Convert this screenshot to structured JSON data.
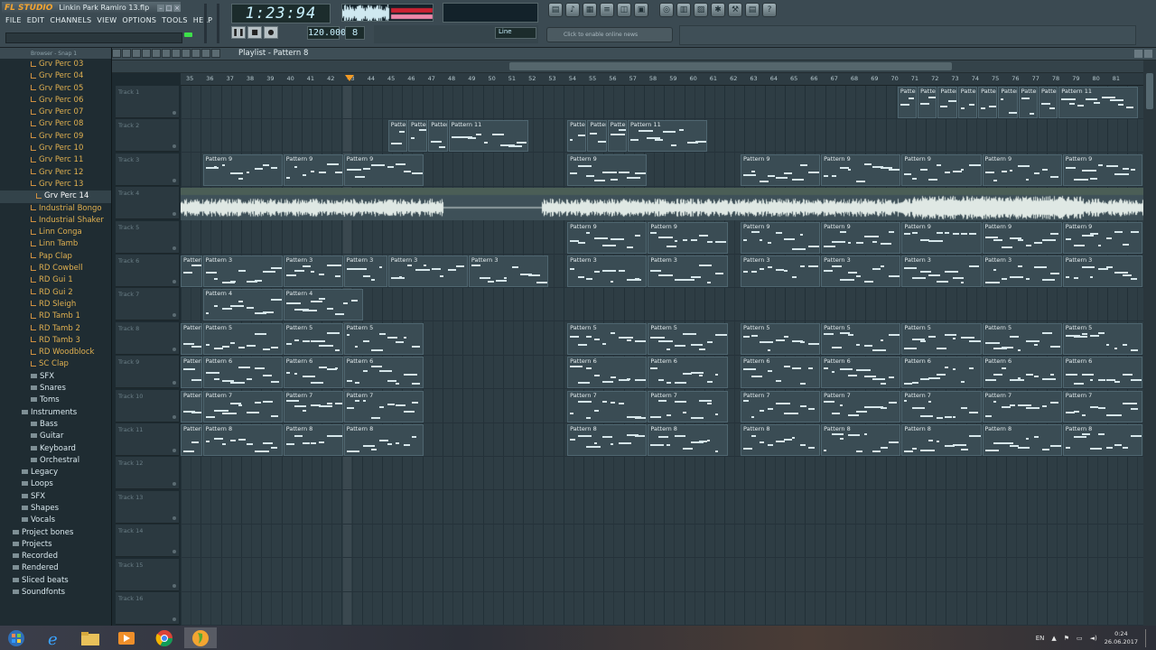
{
  "app": {
    "logo": "FL STUDIO",
    "file_name": "Linkin Park Ramiro 13.flp"
  },
  "menu": [
    "FILE",
    "EDIT",
    "CHANNELS",
    "VIEW",
    "OPTIONS",
    "TOOLS",
    "HELP"
  ],
  "transport": {
    "time": "1:23:94",
    "tempo": "120.000",
    "pattern_num": "8",
    "snap": "Line"
  },
  "news_text": "Click to enable online news",
  "browser": {
    "header": "Browser - Snap 1",
    "items": [
      {
        "label": "Grv Perc 03",
        "kind": "file",
        "indent": 1
      },
      {
        "label": "Grv Perc 04",
        "kind": "file",
        "indent": 1
      },
      {
        "label": "Grv Perc 05",
        "kind": "file",
        "indent": 1
      },
      {
        "label": "Grv Perc 06",
        "kind": "file",
        "indent": 1
      },
      {
        "label": "Grv Perc 07",
        "kind": "file",
        "indent": 1
      },
      {
        "label": "Grv Perc 08",
        "kind": "file",
        "indent": 1
      },
      {
        "label": "Grv Perc 09",
        "kind": "file",
        "indent": 1
      },
      {
        "label": "Grv Perc 10",
        "kind": "file",
        "indent": 1
      },
      {
        "label": "Grv Perc 11",
        "kind": "file",
        "indent": 1
      },
      {
        "label": "Grv Perc 12",
        "kind": "file",
        "indent": 1
      },
      {
        "label": "Grv Perc 13",
        "kind": "file",
        "indent": 1
      },
      {
        "label": "Grv Perc 14",
        "kind": "file",
        "indent": 1,
        "selected": true
      },
      {
        "label": "Industrial Bongo",
        "kind": "file",
        "indent": 1
      },
      {
        "label": "Industrial Shaker",
        "kind": "file",
        "indent": 1
      },
      {
        "label": "Linn Conga",
        "kind": "file",
        "indent": 1
      },
      {
        "label": "Linn Tamb",
        "kind": "file",
        "indent": 1
      },
      {
        "label": "Pap Clap",
        "kind": "file",
        "indent": 1
      },
      {
        "label": "RD Cowbell",
        "kind": "file",
        "indent": 1
      },
      {
        "label": "RD Gui 1",
        "kind": "file",
        "indent": 1
      },
      {
        "label": "RD Gui 2",
        "kind": "file",
        "indent": 1
      },
      {
        "label": "RD Sleigh",
        "kind": "file",
        "indent": 1
      },
      {
        "label": "RD Tamb 1",
        "kind": "file",
        "indent": 1
      },
      {
        "label": "RD Tamb 2",
        "kind": "file",
        "indent": 1
      },
      {
        "label": "RD Tamb 3",
        "kind": "file",
        "indent": 1
      },
      {
        "label": "RD Woodblock",
        "kind": "file",
        "indent": 1
      },
      {
        "label": "SC Clap",
        "kind": "file",
        "indent": 1
      },
      {
        "label": "SFX",
        "kind": "folder",
        "indent": 1
      },
      {
        "label": "Snares",
        "kind": "folder",
        "indent": 1
      },
      {
        "label": "Toms",
        "kind": "folder",
        "indent": 1
      },
      {
        "label": "Instruments",
        "kind": "folder",
        "indent": 0
      },
      {
        "label": "Bass",
        "kind": "folder",
        "indent": 1
      },
      {
        "label": "Guitar",
        "kind": "folder",
        "indent": 1
      },
      {
        "label": "Keyboard",
        "kind": "folder",
        "indent": 1
      },
      {
        "label": "Orchestral",
        "kind": "folder",
        "indent": 1
      },
      {
        "label": "Legacy",
        "kind": "folder",
        "indent": 0
      },
      {
        "label": "Loops",
        "kind": "folder",
        "indent": 0
      },
      {
        "label": "SFX",
        "kind": "folder",
        "indent": 0
      },
      {
        "label": "Shapes",
        "kind": "folder",
        "indent": 0
      },
      {
        "label": "Vocals",
        "kind": "folder",
        "indent": 0
      },
      {
        "label": "Project bones",
        "kind": "folder",
        "indent": -1
      },
      {
        "label": "Projects",
        "kind": "folder",
        "indent": -1
      },
      {
        "label": "Recorded",
        "kind": "folder",
        "indent": -1
      },
      {
        "label": "Rendered",
        "kind": "folder",
        "indent": -1
      },
      {
        "label": "Sliced beats",
        "kind": "folder",
        "indent": -1
      },
      {
        "label": "Soundfonts",
        "kind": "folder",
        "indent": -1
      }
    ]
  },
  "playlist": {
    "title": "Playlist - Pattern 8",
    "ruler_ticks": [
      "35",
      "36",
      "37",
      "38",
      "39",
      "40",
      "41",
      "42",
      "43",
      "44",
      "45",
      "46",
      "47",
      "48",
      "49",
      "50",
      "51",
      "52",
      "53",
      "54",
      "55",
      "56",
      "57",
      "58",
      "59",
      "60",
      "61",
      "62",
      "63",
      "64",
      "65",
      "66",
      "67",
      "68",
      "69",
      "70",
      "71",
      "72",
      "73",
      "74",
      "75",
      "76",
      "77",
      "78",
      "79",
      "80",
      "81"
    ],
    "tracks": [
      {
        "name": "Track 1"
      },
      {
        "name": "Track 2"
      },
      {
        "name": "Track 3"
      },
      {
        "name": "Track 4"
      },
      {
        "name": "Track 5"
      },
      {
        "name": "Track 6"
      },
      {
        "name": "Track 7"
      },
      {
        "name": "Track 8"
      },
      {
        "name": "Track 9"
      },
      {
        "name": "Track 10"
      },
      {
        "name": "Track 11"
      },
      {
        "name": "Track 12"
      },
      {
        "name": "Track 13"
      },
      {
        "name": "Track 14"
      },
      {
        "name": "Track 15"
      },
      {
        "name": "Track 16"
      }
    ],
    "clip_rows": [
      {
        "track": 0,
        "label": "Pattern 11",
        "starts": [
          35.6,
          36.6,
          37.6,
          38.6,
          39.6,
          40.6,
          41.6,
          42.6,
          43.6
        ]
      },
      {
        "track": 1,
        "label": "Pattern 11",
        "starts": [
          10.3,
          11.3,
          12.3,
          13.3,
          19.2,
          20.2,
          21.2,
          22.2
        ]
      },
      {
        "track": 2,
        "label": "Pattern 9",
        "starts": [
          1.1,
          5.1,
          8.1,
          19.2,
          27.8,
          31.8,
          35.8,
          39.8,
          43.8,
          47.8
        ]
      },
      {
        "track": 4,
        "label": "Pattern 9",
        "starts": [
          19.2,
          23.2,
          27.8,
          31.8,
          35.8,
          39.8,
          43.8
        ]
      },
      {
        "track": 5,
        "label": "Pattern 3",
        "starts": [
          0,
          1.1,
          5.1,
          8.1,
          10.3,
          14.3,
          19.2,
          23.2,
          27.8,
          31.8,
          35.8,
          39.8,
          43.8,
          47.8
        ]
      },
      {
        "track": 6,
        "label": "Pattern 4",
        "starts": [
          1.1,
          5.1
        ]
      },
      {
        "track": 7,
        "label": "Pattern 5",
        "starts": [
          0,
          1.1,
          5.1,
          8.1,
          19.2,
          23.2,
          27.8,
          31.8,
          35.8,
          39.8,
          43.8,
          47.8
        ]
      },
      {
        "track": 8,
        "label": "Pattern 6",
        "starts": [
          0,
          1.1,
          5.1,
          8.1,
          19.2,
          23.2,
          27.8,
          31.8,
          35.8,
          39.8,
          43.8,
          47.8
        ]
      },
      {
        "track": 9,
        "label": "Pattern 7",
        "starts": [
          0,
          1.1,
          5.1,
          8.1,
          19.2,
          23.2,
          27.8,
          31.8,
          35.8,
          39.8,
          43.8,
          47.8
        ]
      },
      {
        "track": 10,
        "label": "Pattern 8",
        "starts": [
          0,
          1.1,
          5.1,
          8.1,
          19.2,
          23.2,
          27.8,
          31.8,
          35.8,
          39.8,
          43.8,
          47.8
        ]
      }
    ]
  },
  "tray": {
    "lang": "EN",
    "time": "0:24",
    "date": "26.06.2017"
  },
  "colors": {
    "accent": "#f3a531",
    "clip_bg": "#3a4c54",
    "grid_bg": "#2e3d44",
    "led": "#3ddf4a"
  }
}
